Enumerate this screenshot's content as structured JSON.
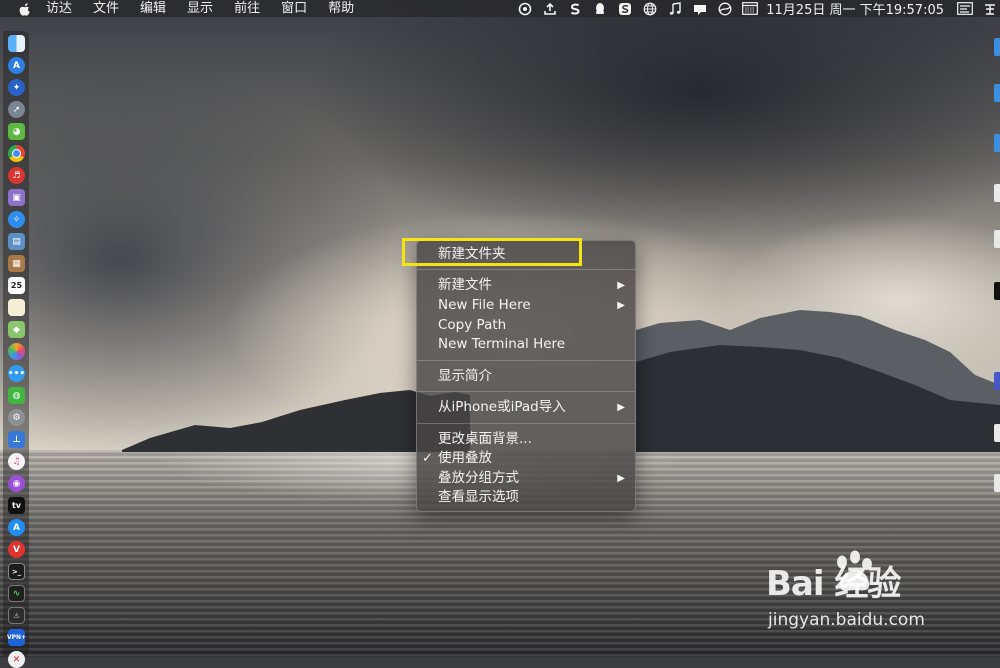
{
  "menubar": {
    "items": [
      "访达",
      "文件",
      "编辑",
      "显示",
      "前往",
      "窗口",
      "帮助"
    ],
    "clock": "11月25日 周一 下午19:57:05",
    "status_icons": [
      "sync-icon",
      "upload-icon",
      "s-app-icon",
      "qq-icon",
      "sogou-icon",
      "globe-icon",
      "music-note-icon",
      "notification-icon",
      "vpn-icon",
      "calendar-icon",
      "menu-extra-icon",
      "input-method-icon"
    ]
  },
  "context_menu": {
    "new_folder": "新建文件夹",
    "new_file": "新建文件",
    "new_file_here": "New File Here",
    "copy_path": "Copy Path",
    "new_terminal_here": "New Terminal Here",
    "get_info": "显示简介",
    "import_from_iphone": "从iPhone或iPad导入",
    "change_bg": "更改桌面背景...",
    "use_stacks": "使用叠放",
    "group_stacks_by": "叠放分组方式",
    "show_view_options": "查看显示选项",
    "submenu_arrow": "▶",
    "checkmark": "✓"
  },
  "dock": {
    "icons": [
      "finder-icon",
      "app-store-icon",
      "safari-compass-icon",
      "launchpad-rocket-icon",
      "android-icon",
      "chrome-icon",
      "music-app-icon",
      "disk-icon",
      "safari-icon",
      "preview-icon",
      "notes-icon",
      "calendar-icon",
      "text-edit-icon",
      "maps-icon",
      "photos-icon",
      "messages-icon",
      "wechat-icon",
      "settings-icon",
      "keynote-icon",
      "itunes-icon",
      "podcasts-icon",
      "apple-tv-icon",
      "app-store-blue-icon",
      "vivaldi-icon",
      "terminal-icon",
      "activity-monitor-icon",
      "console-icon",
      "vpn-app-icon",
      "close-red-icon"
    ],
    "calendar_day": "25",
    "apple_tv_label": "tv",
    "vpn_label": "VPN+"
  },
  "watermark": {
    "brand": "Bai 经验",
    "url": "jingyan.baidu.com"
  },
  "colors": {
    "highlight": "#f5e414",
    "menu_bg": "#484646"
  }
}
